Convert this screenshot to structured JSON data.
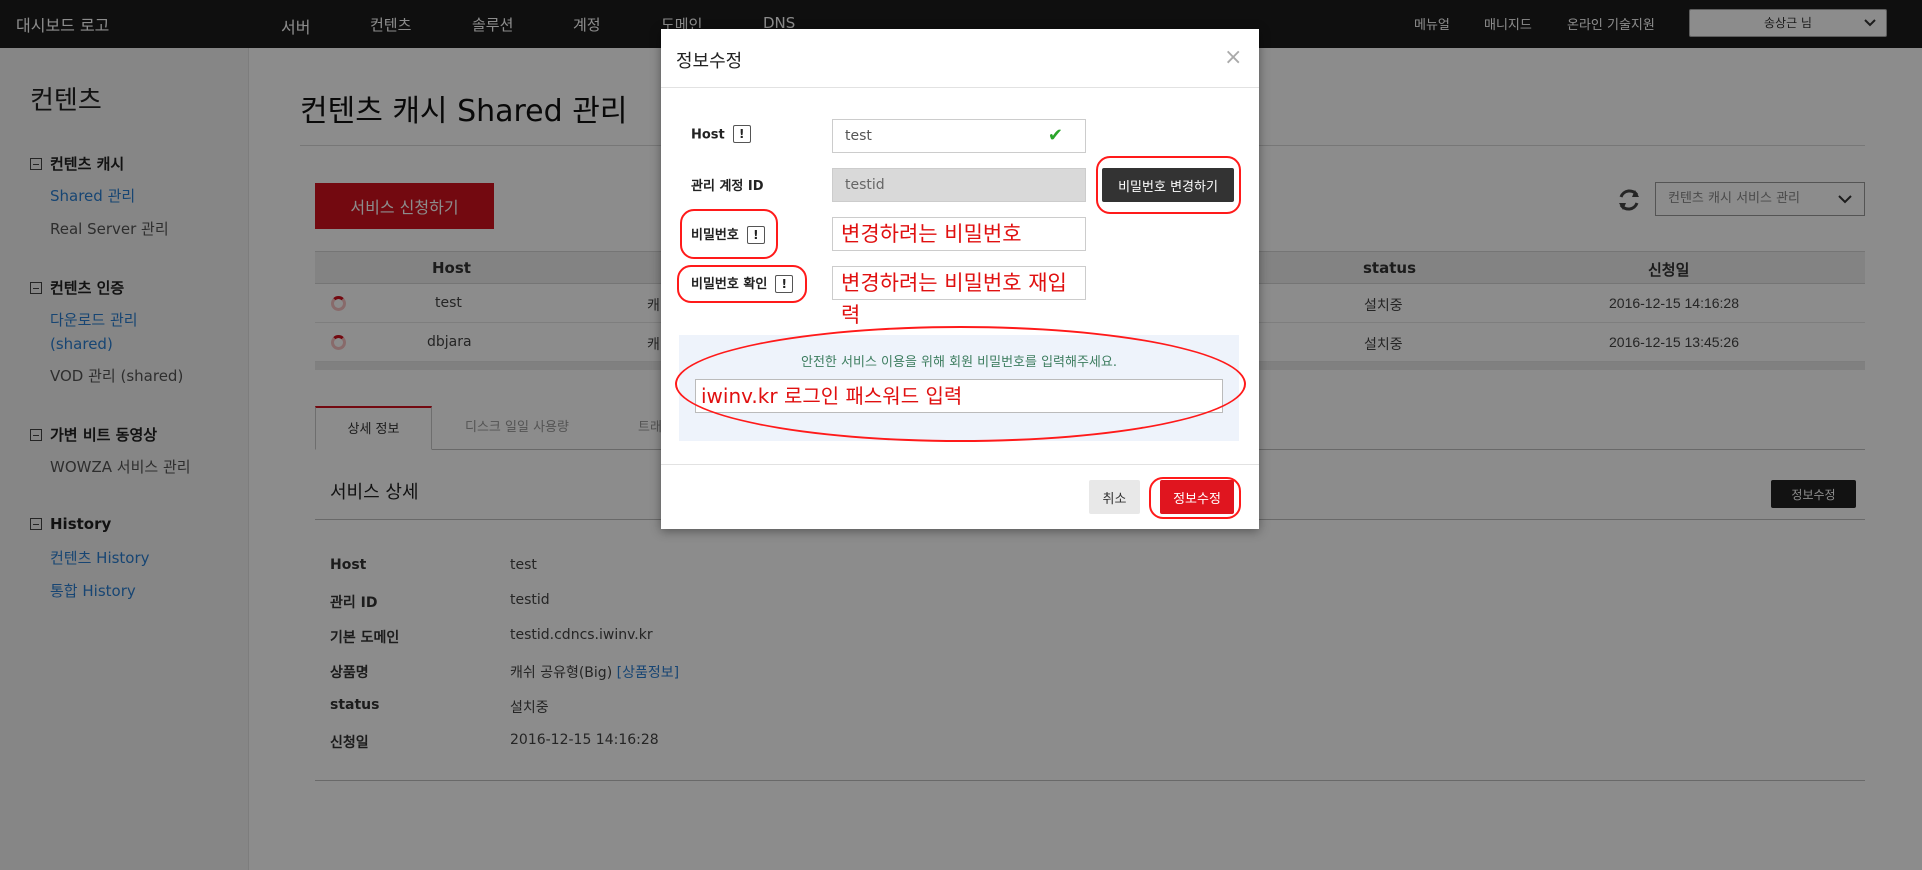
{
  "topnav": {
    "logo": "대시보드 로고",
    "menu": [
      "서버",
      "컨텐츠",
      "솔루션",
      "계정",
      "도메인",
      "DNS"
    ],
    "right": [
      "메뉴얼",
      "매니지드",
      "온라인 기술지원"
    ],
    "user": "송상근 님"
  },
  "sidebar": {
    "title": "컨텐츠",
    "groups": [
      {
        "label": "컨텐츠 캐시",
        "items": [
          "Shared 관리",
          "Real Server 관리"
        ]
      },
      {
        "label": "컨텐츠 인증",
        "items": [
          "다운로드 관리",
          "(shared)",
          "VOD 관리 (shared)"
        ]
      },
      {
        "label": "가변 비트 동영상",
        "items": [
          "WOWZA 서비스 관리"
        ]
      },
      {
        "label": "History",
        "items": [
          "컨텐츠 History",
          "통합 History"
        ]
      }
    ]
  },
  "main": {
    "title": "컨텐츠 캐시 Shared 관리",
    "apply_button": "서비스 신청하기",
    "service_select": "컨텐츠 캐시 서비스 관리",
    "table": {
      "headers": [
        "Host",
        "status",
        "신청일"
      ],
      "rows": [
        {
          "host": "test",
          "type": "캐",
          "status": "설치중",
          "date": "2016-12-15 14:16:28"
        },
        {
          "host": "dbjara",
          "type": "캐",
          "status": "설치중",
          "date": "2016-12-15 13:45:26"
        }
      ]
    },
    "tabs": [
      "상세 정보",
      "디스크 일일 사용량",
      "트래"
    ],
    "detail": {
      "title": "서비스 상세",
      "edit_button": "정보수정",
      "rows": [
        {
          "label": "Host",
          "value": "test"
        },
        {
          "label": "관리 ID",
          "value": "testid"
        },
        {
          "label": "기본 도메인",
          "value": "testid.cdncs.iwinv.kr"
        },
        {
          "label": "상품명",
          "value": "캐쉬 공유형(Big)",
          "link": "[상품정보]"
        },
        {
          "label": "status",
          "value": "설치중"
        },
        {
          "label": "신청일",
          "value": "2016-12-15 14:16:28"
        }
      ]
    }
  },
  "modal": {
    "title": "정보수정",
    "close": "×",
    "fields": {
      "host": {
        "label": "Host",
        "value": "test"
      },
      "account_id": {
        "label": "관리 계정 ID",
        "value": "testid"
      },
      "password": {
        "label": "비밀번호",
        "value": "변경하려는 비밀번호"
      },
      "password_confirm": {
        "label": "비밀번호 확인",
        "value": "변경하려는 비밀번호 재입력"
      }
    },
    "info_mark": "!",
    "change_password_button": "비밀번호 변경하기",
    "notice": "안전한 서비스 이용을 위해 회원 비밀번호를 입력해주세요.",
    "member_password_value": "iwinv.kr 로그인 패스워드  입력",
    "cancel_button": "취소",
    "save_button": "정보수정"
  },
  "colors": {
    "accent_red": "#d2121e",
    "link_blue": "#2b7fd1",
    "annotation_red": "#ff1a1a"
  }
}
